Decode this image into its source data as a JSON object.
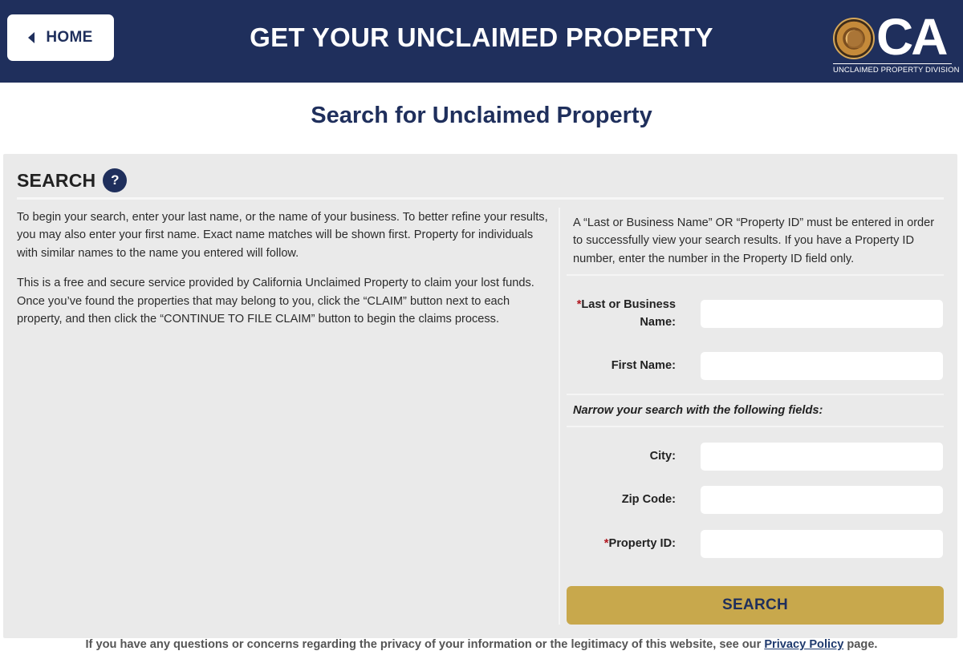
{
  "header": {
    "home_label": "HOME",
    "title": "GET YOUR UNCLAIMED PROPERTY",
    "logo_letters": "CA",
    "logo_division": "UNCLAIMED PROPERTY DIVISION",
    "background_color": "#1f2f5c"
  },
  "page": {
    "heading": "Search for Unclaimed Property"
  },
  "search": {
    "section_label": "SEARCH",
    "help_icon_glyph": "?",
    "intro_paragraphs": [
      "To begin your search, enter your last name, or the name of your business. To better refine your results, you may also enter your first name. Exact name matches will be shown first. Property for individuals with similar names to the name you entered will follow.",
      "This is a free and secure service provided by California Unclaimed Property to claim your lost funds. Once you’ve found the properties that may belong to you, click the “CLAIM” button next to each property, and then click the “CONTINUE TO FILE CLAIM” button to begin the claims process."
    ],
    "notice": "A “Last or Business Name” OR “Property ID” must be entered in order to successfully view your search results. If you have a Property ID number, enter the number in the Property ID field only.",
    "fields": {
      "last_name": {
        "required_mark": "*",
        "label": "Last or Business Name:",
        "value": ""
      },
      "first_name": {
        "label": "First Name:",
        "value": ""
      },
      "narrow_heading": "Narrow your search with the following fields:",
      "city": {
        "label": "City:",
        "value": ""
      },
      "zip": {
        "label": "Zip Code:",
        "value": ""
      },
      "property_id": {
        "required_mark": "*",
        "label": "Property ID:",
        "value": ""
      }
    },
    "submit_label": "SEARCH",
    "submit_color": "#c8a84c"
  },
  "footer": {
    "text_before": "If you have any questions or concerns regarding the privacy of your information or the legitimacy of this website, see our",
    "link_label": "Privacy Policy",
    "text_after": "page."
  }
}
